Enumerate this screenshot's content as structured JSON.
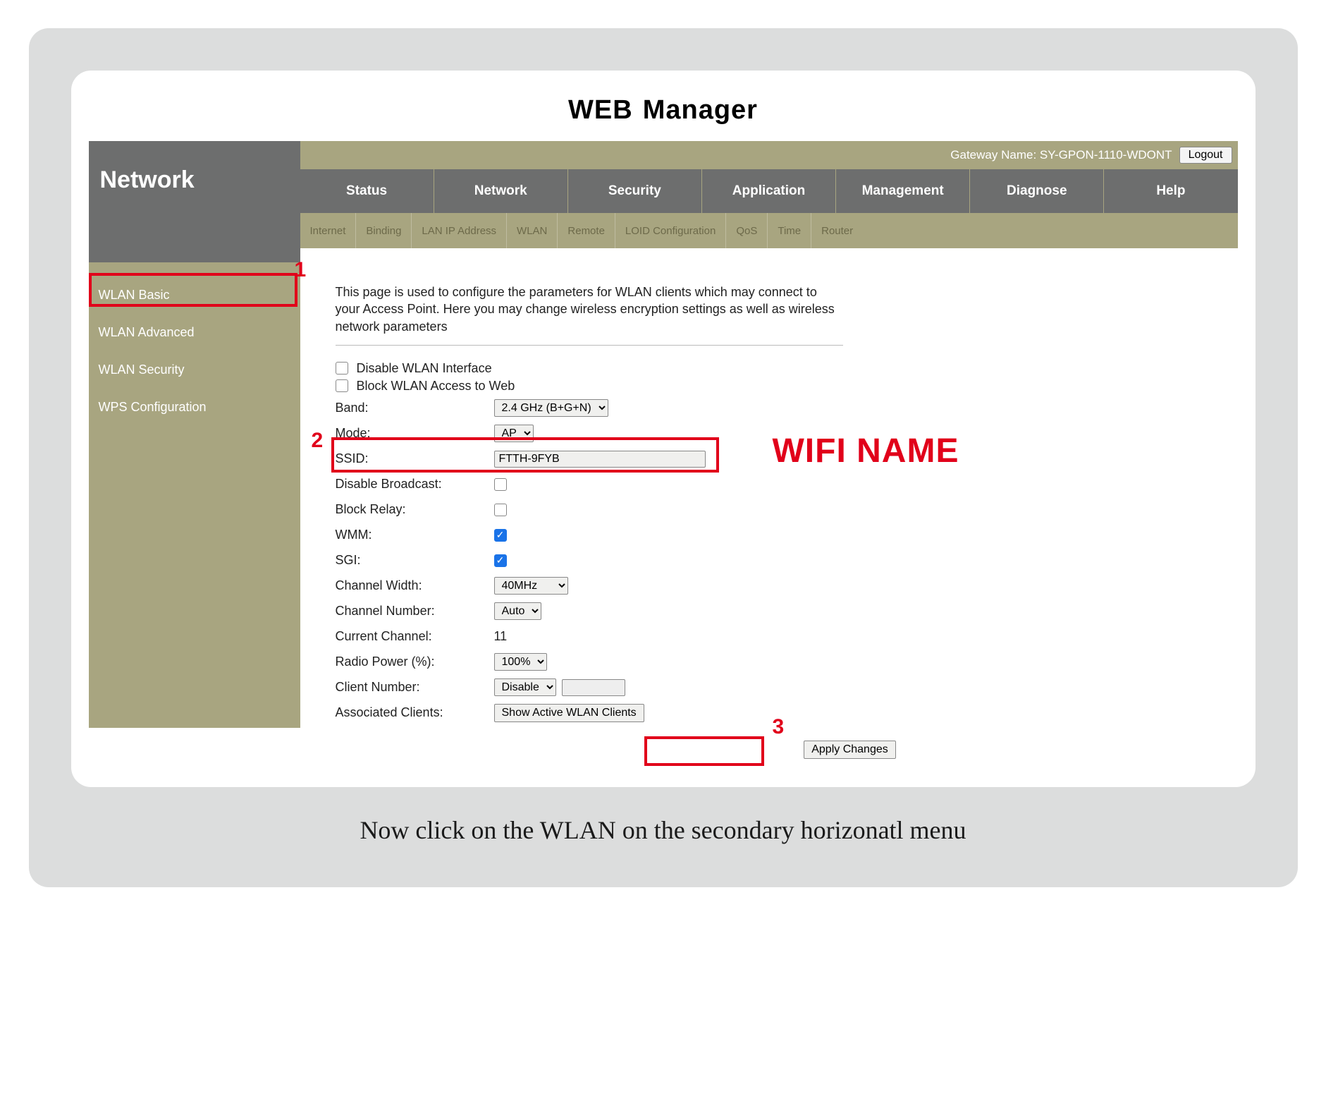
{
  "page_title_a": "WEB",
  "page_title_b": "Manager",
  "gateway_name": "Gateway Name: SY-GPON-1110-WDONT",
  "logout_label": "Logout",
  "section_title": "Network",
  "main_tabs": [
    {
      "label": "Status"
    },
    {
      "label": "Network"
    },
    {
      "label": "Security"
    },
    {
      "label": "Application"
    },
    {
      "label": "Management"
    },
    {
      "label": "Diagnose"
    },
    {
      "label": "Help"
    }
  ],
  "sub_tabs": [
    {
      "label": "Internet"
    },
    {
      "label": "Binding"
    },
    {
      "label": "LAN IP Address"
    },
    {
      "label": "WLAN"
    },
    {
      "label": "Remote"
    },
    {
      "label": "LOID Configuration"
    },
    {
      "label": "QoS"
    },
    {
      "label": "Time"
    },
    {
      "label": "Router"
    }
  ],
  "sidebar": [
    {
      "label": "WLAN Basic"
    },
    {
      "label": "WLAN Advanced"
    },
    {
      "label": "WLAN Security"
    },
    {
      "label": "WPS Configuration"
    }
  ],
  "intro": "This page is used to configure the parameters for WLAN clients which may connect to your Access Point. Here you may change wireless encryption settings as well as wireless network parameters",
  "form": {
    "disable_wlan_label": "Disable WLAN Interface",
    "block_web_label": "Block WLAN Access to Web",
    "band_label": "Band:",
    "band_value": "2.4 GHz (B+G+N)",
    "mode_label": "Mode:",
    "mode_value": "AP",
    "ssid_label": "SSID:",
    "ssid_value": "FTTH-9FYB",
    "disable_broadcast_label": "Disable Broadcast:",
    "block_relay_label": "Block Relay:",
    "wmm_label": "WMM:",
    "sgi_label": "SGI:",
    "ch_width_label": "Channel Width:",
    "ch_width_value": "40MHz",
    "ch_number_label": "Channel Number:",
    "ch_number_value": "Auto",
    "current_ch_label": "Current Channel:",
    "current_ch_value": "11",
    "radio_power_label": "Radio Power (%):",
    "radio_power_value": "100%",
    "client_number_label": "Client Number:",
    "client_number_value": "Disable",
    "assoc_clients_label": "Associated Clients:",
    "show_clients_btn": "Show Active WLAN Clients",
    "apply_btn": "Apply Changes"
  },
  "annotations": {
    "n1": "1",
    "n2": "2",
    "n3": "3",
    "wifi_name": "WIFI NAME"
  },
  "instruction": "Now click on the WLAN on the secondary horizonatl menu"
}
